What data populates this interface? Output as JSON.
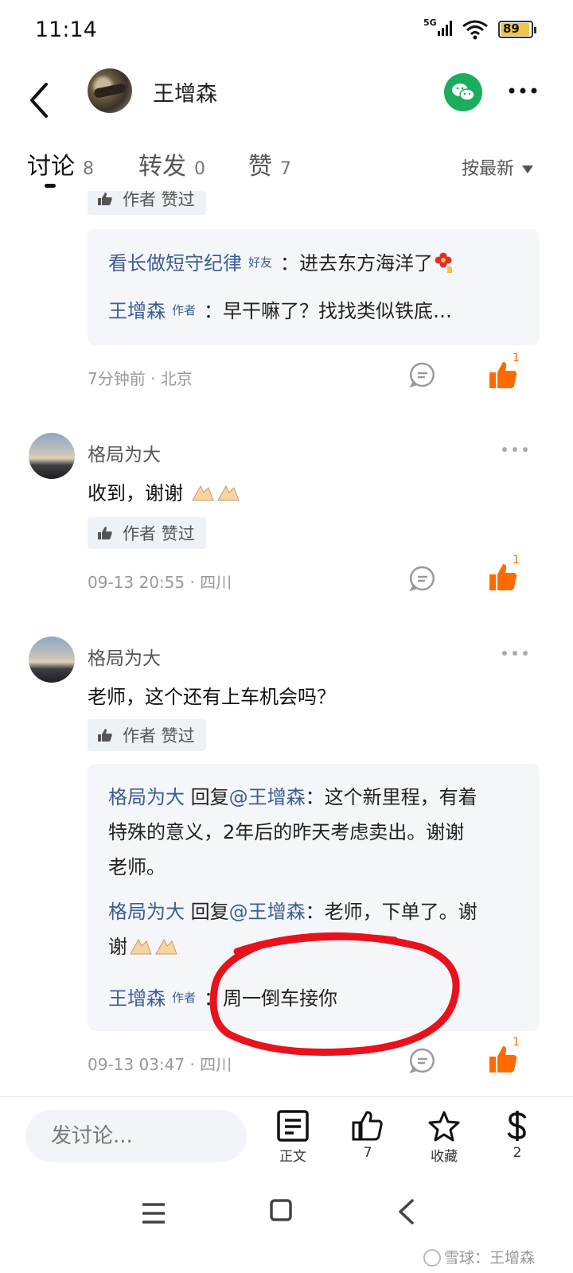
{
  "status_bar": {
    "time": "11:14",
    "network": "5G",
    "battery": "89"
  },
  "header": {
    "username": "王增森"
  },
  "tabs": [
    {
      "label": "讨论",
      "count": "8"
    },
    {
      "label": "转发",
      "count": "0"
    },
    {
      "label": "赞",
      "count": "7"
    }
  ],
  "sort_label": "按最新",
  "badges": {
    "author_liked": "作者 赞过"
  },
  "thread0": {
    "replies": [
      {
        "name": "看长做短守纪律",
        "tag": "好友",
        "text": "：进去东方海洋了"
      },
      {
        "name": "王增森",
        "tag": "作者",
        "text": "：早干嘛了？找找类似铁底…"
      }
    ],
    "meta": "7分钟前 · 北京",
    "likes": "1"
  },
  "comment1": {
    "name": "格局为大",
    "text": "收到，谢谢",
    "meta": "09-13 20:55 · 四川",
    "likes": "1"
  },
  "comment2": {
    "name": "格局为大",
    "text": "老师，这个还有上车机会吗？",
    "replies": [
      {
        "name": "格局为大",
        "reply_prefix": " 回复",
        "mention": "@王增森",
        "text_line1": "：这个新里程，有着",
        "text_line2": "特殊的意义，2年后的昨天考虑卖出。谢谢",
        "text_line3": "老师。"
      },
      {
        "name": "格局为大",
        "reply_prefix": " 回复",
        "mention": "@王增森",
        "text_line1": "：老师，下单了。谢",
        "text_line2": "谢"
      },
      {
        "name": "王增森",
        "tag": "作者",
        "text": "：周一倒车接你"
      }
    ],
    "meta": "09-13 03:47 · 四川",
    "likes": "1"
  },
  "bottom_bar": {
    "input_placeholder": "发讨论...",
    "article_label": "正文",
    "like_count": "7",
    "favorite_label": "收藏",
    "reward_count": "2"
  },
  "watermark": "雪球：王增森",
  "colors": {
    "accent_like": "#ff6a00",
    "name_link": "#3b5e91",
    "wechat": "#1aad5c",
    "annotation": "#e8121c"
  }
}
